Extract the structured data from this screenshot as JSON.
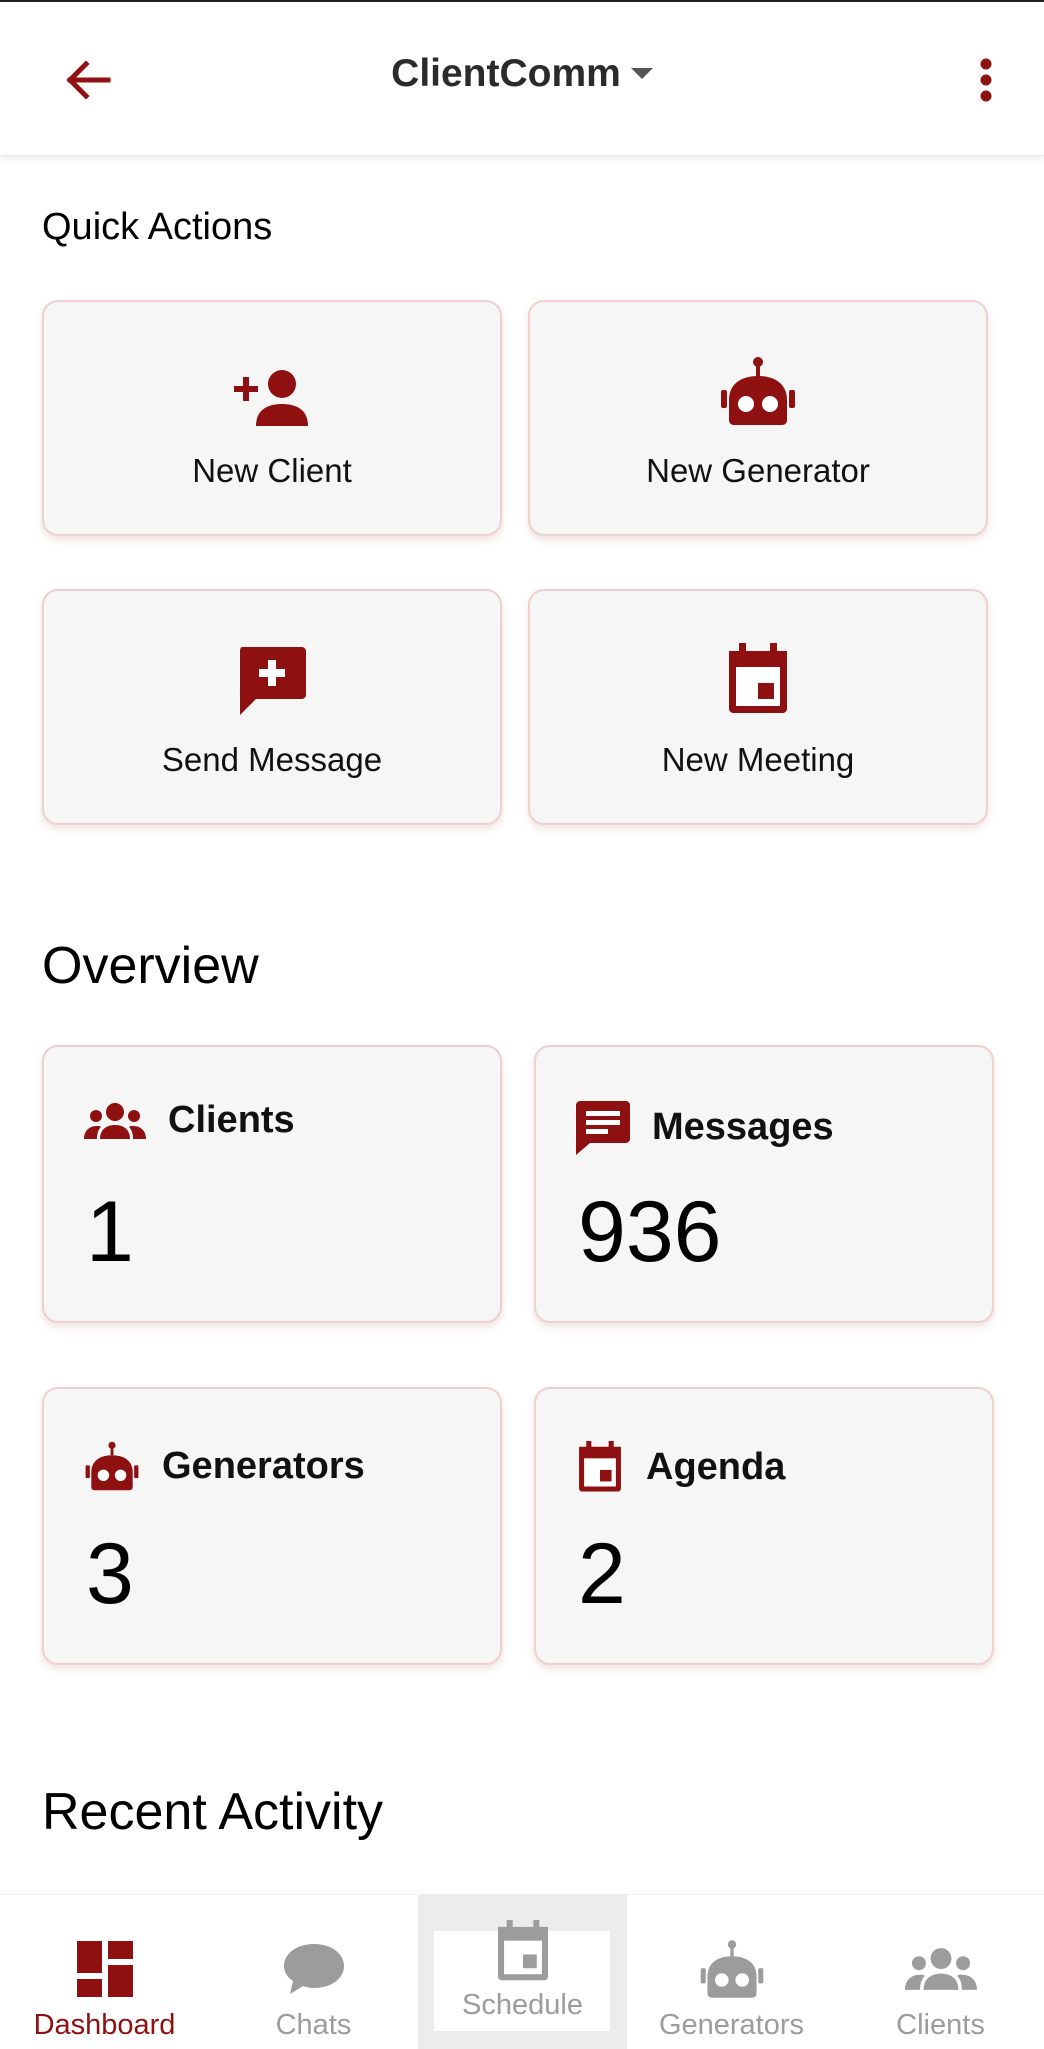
{
  "header": {
    "title": "ClientComm"
  },
  "quick_actions": {
    "title": "Quick Actions",
    "items": [
      {
        "label": "New Client",
        "icon": "person-add-icon"
      },
      {
        "label": "New Generator",
        "icon": "robot-icon"
      },
      {
        "label": "Send Message",
        "icon": "add-comment-icon"
      },
      {
        "label": "New Meeting",
        "icon": "event-icon"
      }
    ]
  },
  "overview": {
    "title": "Overview",
    "stats": [
      {
        "label": "Clients",
        "value": "1",
        "icon": "group-icon"
      },
      {
        "label": "Messages",
        "value": "936",
        "icon": "chat-icon"
      },
      {
        "label": "Generators",
        "value": "3",
        "icon": "robot-icon"
      },
      {
        "label": "Agenda",
        "value": "2",
        "icon": "event-icon"
      }
    ]
  },
  "recent_activity": {
    "title": "Recent Activity"
  },
  "nav": {
    "items": [
      {
        "label": "Dashboard",
        "icon": "dashboard-icon",
        "active": true
      },
      {
        "label": "Chats",
        "icon": "chat-bubble-icon",
        "active": false
      },
      {
        "label": "Schedule",
        "icon": "event-icon",
        "active": false
      },
      {
        "label": "Generators",
        "icon": "robot-icon",
        "active": false
      },
      {
        "label": "Clients",
        "icon": "group-icon",
        "active": false
      }
    ]
  },
  "colors": {
    "accent": "#8e1010",
    "inactive": "#9c9c9c",
    "card_bg": "#f7f6f6",
    "card_border": "#f0cfcf"
  }
}
